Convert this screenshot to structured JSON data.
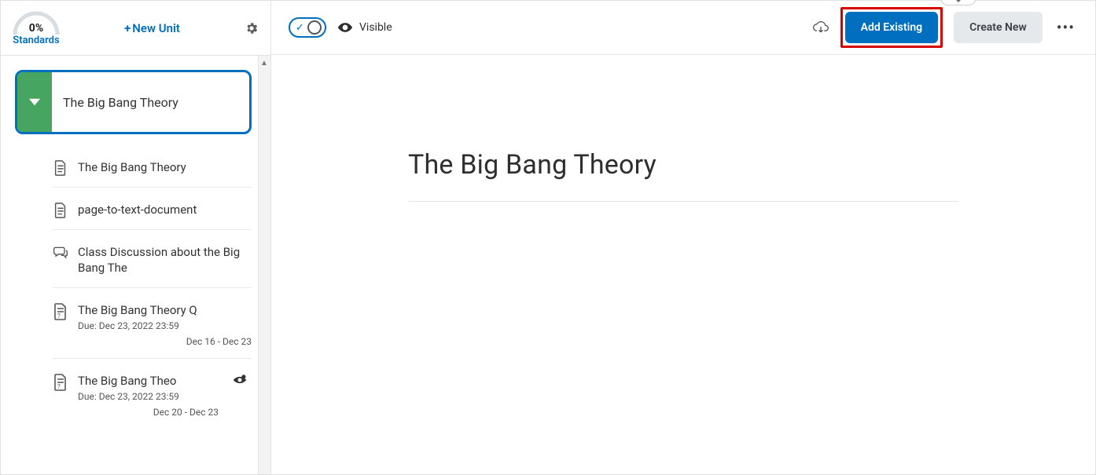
{
  "sidebar": {
    "gauge_pct": "0%",
    "standards_label": "Standards",
    "new_unit_label": "New Unit",
    "unit": {
      "title": "The Big Bang Theory"
    },
    "items": [
      {
        "title": "The Big Bang Theory",
        "icon": "doc"
      },
      {
        "title": "page-to-text-document",
        "icon": "doc"
      },
      {
        "title": "Class Discussion about the Big Bang The",
        "icon": "discussion"
      },
      {
        "title": "The Big Bang Theory Q",
        "icon": "quiz",
        "due": "Due: Dec 23, 2022 23:59",
        "dates": "Dec 16 - Dec 23"
      },
      {
        "title": "The Big Bang Theo",
        "icon": "quiz",
        "due": "Due: Dec 23, 2022 23:59",
        "dates": "Dec 20 - Dec 23",
        "special_vis": true
      }
    ]
  },
  "toolbar": {
    "visible_label": "Visible",
    "add_existing_label": "Add Existing",
    "create_new_label": "Create New"
  },
  "page": {
    "title": "The Big Bang Theory"
  }
}
